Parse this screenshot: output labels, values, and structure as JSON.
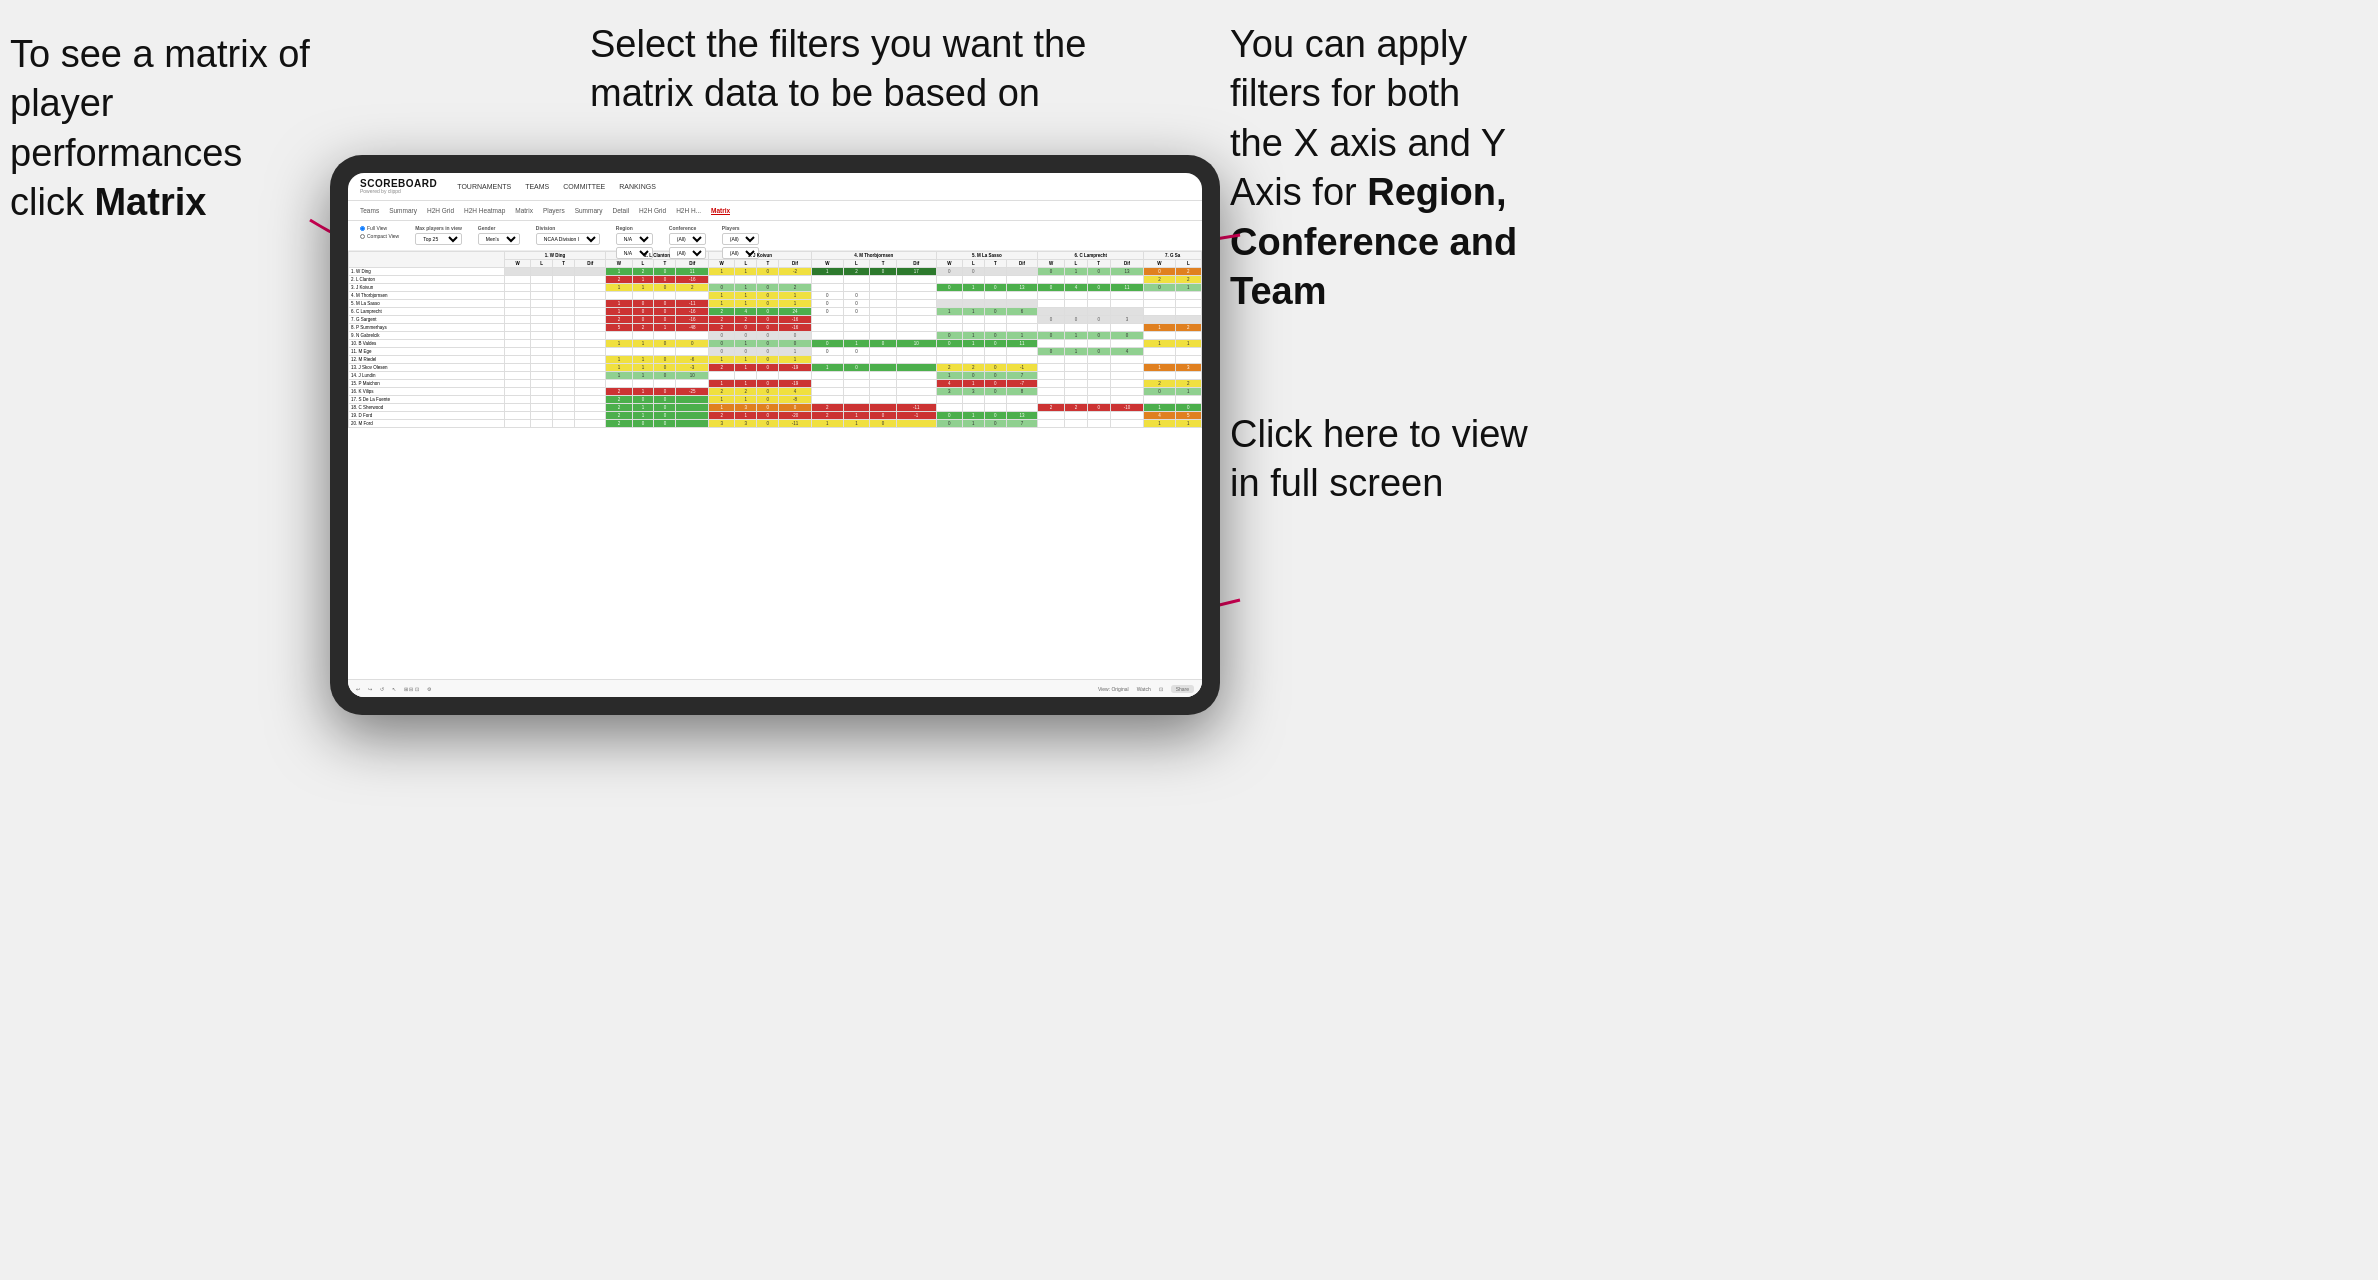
{
  "annotations": {
    "top_left": {
      "line1": "To see a matrix of",
      "line2": "player performances",
      "line3_prefix": "click ",
      "line3_bold": "Matrix"
    },
    "top_center": {
      "text": "Select the filters you want the matrix data to be based on"
    },
    "top_right": {
      "line1": "You  can apply",
      "line2": "filters for both",
      "line3": "the X axis and Y",
      "line4_prefix": "Axis for ",
      "line4_bold": "Region,",
      "line5_bold": "Conference and",
      "line6_bold": "Team"
    },
    "bottom_right": {
      "line1": "Click here to view",
      "line2": "in full screen"
    }
  },
  "app": {
    "logo": "SCOREBOARD",
    "logo_sub": "Powered by clippd",
    "nav": [
      "TOURNAMENTS",
      "TEAMS",
      "COMMITTEE",
      "RANKINGS"
    ],
    "sub_nav": [
      "Teams",
      "Summary",
      "H2H Grid",
      "H2H Heatmap",
      "Matrix",
      "Players",
      "Summary",
      "Detail",
      "H2H Grid",
      "H2H H...",
      "Matrix"
    ],
    "active_sub_nav": "Matrix"
  },
  "filters": {
    "view_options": [
      "Full View",
      "Compact View"
    ],
    "max_players_label": "Max players in view",
    "max_players_value": "Top 25",
    "gender_label": "Gender",
    "gender_value": "Men's",
    "division_label": "Division",
    "division_value": "NCAA Division I",
    "region_label": "Region",
    "region_values": [
      "N/A",
      "N/A"
    ],
    "conference_label": "Conference",
    "conference_values": [
      "(All)",
      "(All)"
    ],
    "players_label": "Players",
    "players_values": [
      "(All)",
      "(All)"
    ]
  },
  "matrix": {
    "columns": [
      "",
      "1. W Ding",
      "2. L Clanton",
      "3. J Koivun",
      "4. M Thorbjornsen",
      "5. M La Sasso",
      "6. C Lamprecht",
      "7. G Sa"
    ],
    "col_sub": [
      "W",
      "L",
      "T",
      "Dif"
    ],
    "rows": [
      {
        "name": "1. W Ding",
        "cells": [
          [
            "",
            "",
            "",
            ""
          ],
          [
            "",
            "1",
            "2",
            "0",
            "11"
          ],
          [
            "1",
            "1",
            "0",
            "-2"
          ],
          [
            "1",
            "2",
            "0",
            "17"
          ],
          [
            "0",
            "0",
            "",
            ""
          ],
          [
            "0",
            "1",
            "0",
            "13"
          ],
          [
            "0",
            "2",
            ""
          ]
        ]
      },
      {
        "name": "2. L Clanton"
      },
      {
        "name": "3. J Koivun"
      },
      {
        "name": "4. M Thorbjornsen"
      },
      {
        "name": "5. M La Sasso"
      },
      {
        "name": "6. C Lamprecht"
      },
      {
        "name": "7. G Sargent"
      },
      {
        "name": "8. P Summerhays"
      },
      {
        "name": "9. N Gabrelcik"
      },
      {
        "name": "10. B Valdes"
      },
      {
        "name": "11. M Ege"
      },
      {
        "name": "12. M Riedel"
      },
      {
        "name": "13. J Skov Olesen"
      },
      {
        "name": "14. J Lundin"
      },
      {
        "name": "15. P Maichon"
      },
      {
        "name": "16. K Vilips"
      },
      {
        "name": "17. S De La Fuente"
      },
      {
        "name": "18. C Sherwood"
      },
      {
        "name": "19. D Ford"
      },
      {
        "name": "20. M Ford"
      }
    ]
  },
  "toolbar": {
    "view_label": "View: Original",
    "watch_label": "Watch",
    "share_label": "Share"
  }
}
